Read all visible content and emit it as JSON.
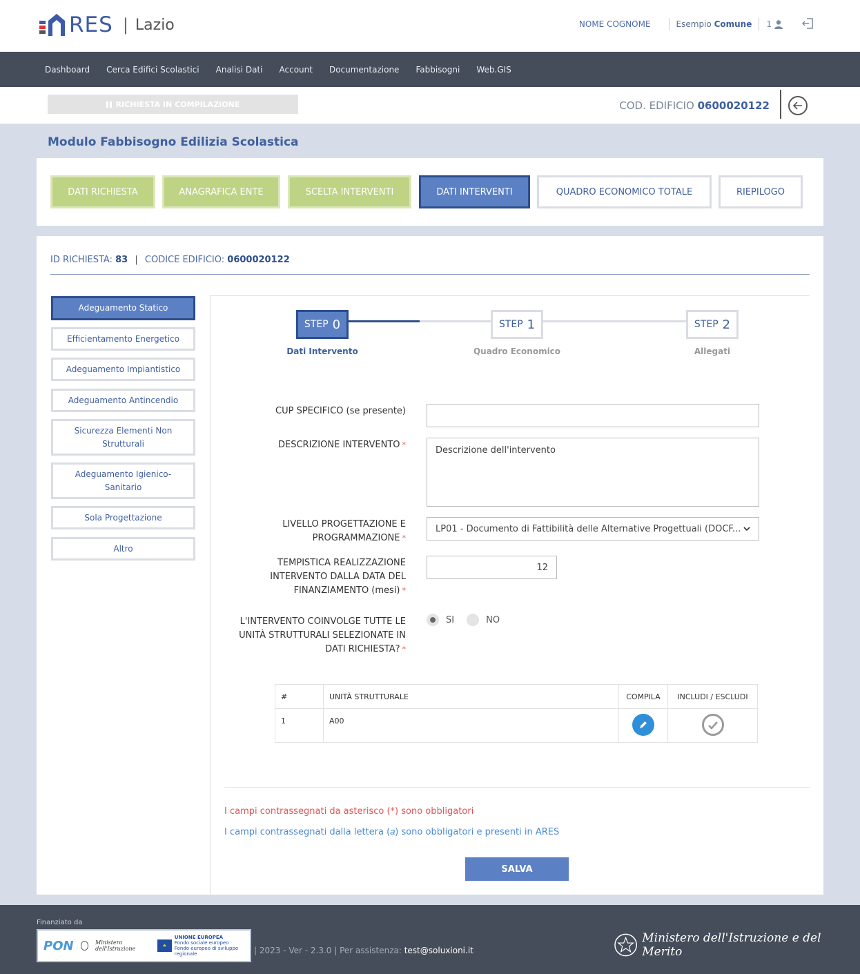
{
  "header": {
    "logo_text": "RES",
    "region": "Lazio",
    "user_name": "NOME COGNOME",
    "comune_prefix": "Esempio",
    "comune_name": "Comune",
    "user_count": "1"
  },
  "nav": {
    "items": [
      "Dashboard",
      "Cerca Edifici Scolastici",
      "Analisi Dati",
      "Account",
      "Documentazione",
      "Fabbisogni",
      "Web.GIS"
    ]
  },
  "status": {
    "label": "RICHIESTA IN COMPILAZIONE",
    "cod_label": "COD. EDIFICIO",
    "cod_value": "0600020122"
  },
  "page": {
    "title": "Modulo Fabbisogno Edilizia Scolastica"
  },
  "tabs": [
    {
      "label": "DATI RICHIESTA",
      "state": "done"
    },
    {
      "label": "ANAGRAFICA ENTE",
      "state": "done"
    },
    {
      "label": "SCELTA INTERVENTI",
      "state": "done"
    },
    {
      "label": "DATI INTERVENTI",
      "state": "active"
    },
    {
      "label": "QUADRO ECONOMICO TOTALE",
      "state": "todo"
    },
    {
      "label": "RIEPILOGO",
      "state": "todo"
    }
  ],
  "request": {
    "id_label": "ID RICHIESTA:",
    "id_value": "83",
    "codice_label": "CODICE EDIFICIO:",
    "codice_value": "0600020122"
  },
  "sidebar": {
    "items": [
      "Adeguamento Statico",
      "Efficientamento Energetico",
      "Adeguamento Impiantistico",
      "Adeguamento Antincendio",
      "Sicurezza Elementi Non Strutturali",
      "Adeguamento Igienico-Sanitario",
      "Sola Progettazione",
      "Altro"
    ],
    "active_index": 0
  },
  "steps": [
    {
      "prefix": "STEP",
      "num": "0",
      "label": "Dati Intervento"
    },
    {
      "prefix": "STEP",
      "num": "1",
      "label": "Quadro Economico"
    },
    {
      "prefix": "STEP",
      "num": "2",
      "label": "Allegati"
    }
  ],
  "form": {
    "cup_label": "CUP SPECIFICO (se presente)",
    "cup_value": "",
    "descr_label": "DESCRIZIONE INTERVENTO",
    "descr_value": "Descrizione dell'intervento",
    "livello_label_1": "LIVELLO PROGETTAZIONE E",
    "livello_label_2": "PROGRAMMAZIONE",
    "livello_value": "LP01 - Documento di Fattibilità delle Alternative Progettuali (DOCF...",
    "tempistica_label_1": "TEMPISTICA REALIZZAZIONE",
    "tempistica_label_2": "INTERVENTO DALLA DATA DEL",
    "tempistica_label_3": "FINANZIAMENTO (mesi)",
    "tempistica_value": "12",
    "coinvolge_label_1": "L'INTERVENTO COINVOLGE TUTTE LE",
    "coinvolge_label_2": "UNITÀ STRUTTURALI SELEZIONATE IN",
    "coinvolge_label_3": "DATI RICHIESTA?",
    "radio_si": "SI",
    "radio_no": "NO",
    "radio_selected": "SI",
    "required_mark": "*"
  },
  "table": {
    "headers": [
      "#",
      "UNITÀ STRUTTURALE",
      "COMPILA",
      "INCLUDI / ESCLUDI"
    ],
    "rows": [
      {
        "num": "1",
        "unit": "A00"
      }
    ]
  },
  "notes": {
    "red": "I campi contrassegnati da asterisco (*) sono obbligatori",
    "blue": "I campi contrassegnati dalla lettera (𝑎) sono obbligatori e presenti in ARES"
  },
  "actions": {
    "save": "SALVA"
  },
  "footer": {
    "financed": "Finanziato da",
    "pon": "PON",
    "ministero_small": "Ministero dell'Istruzione",
    "eu_title": "UNIONE EUROPEA",
    "eu_sub1": "Fondo sociale europeo",
    "eu_sub2": "Fondo europeo di sviluppo regionale",
    "version": "| 2023 - Ver - 2.3.0  | Per assistenza:",
    "email": "test@soluxioni.it",
    "ministero": "Ministero dell'Istruzione e del Merito"
  },
  "colors": {
    "primary": "#3f5f9f",
    "active_fill": "#5b80c4",
    "done_fill": "#bfd384",
    "nav_bg": "#454d5a"
  }
}
